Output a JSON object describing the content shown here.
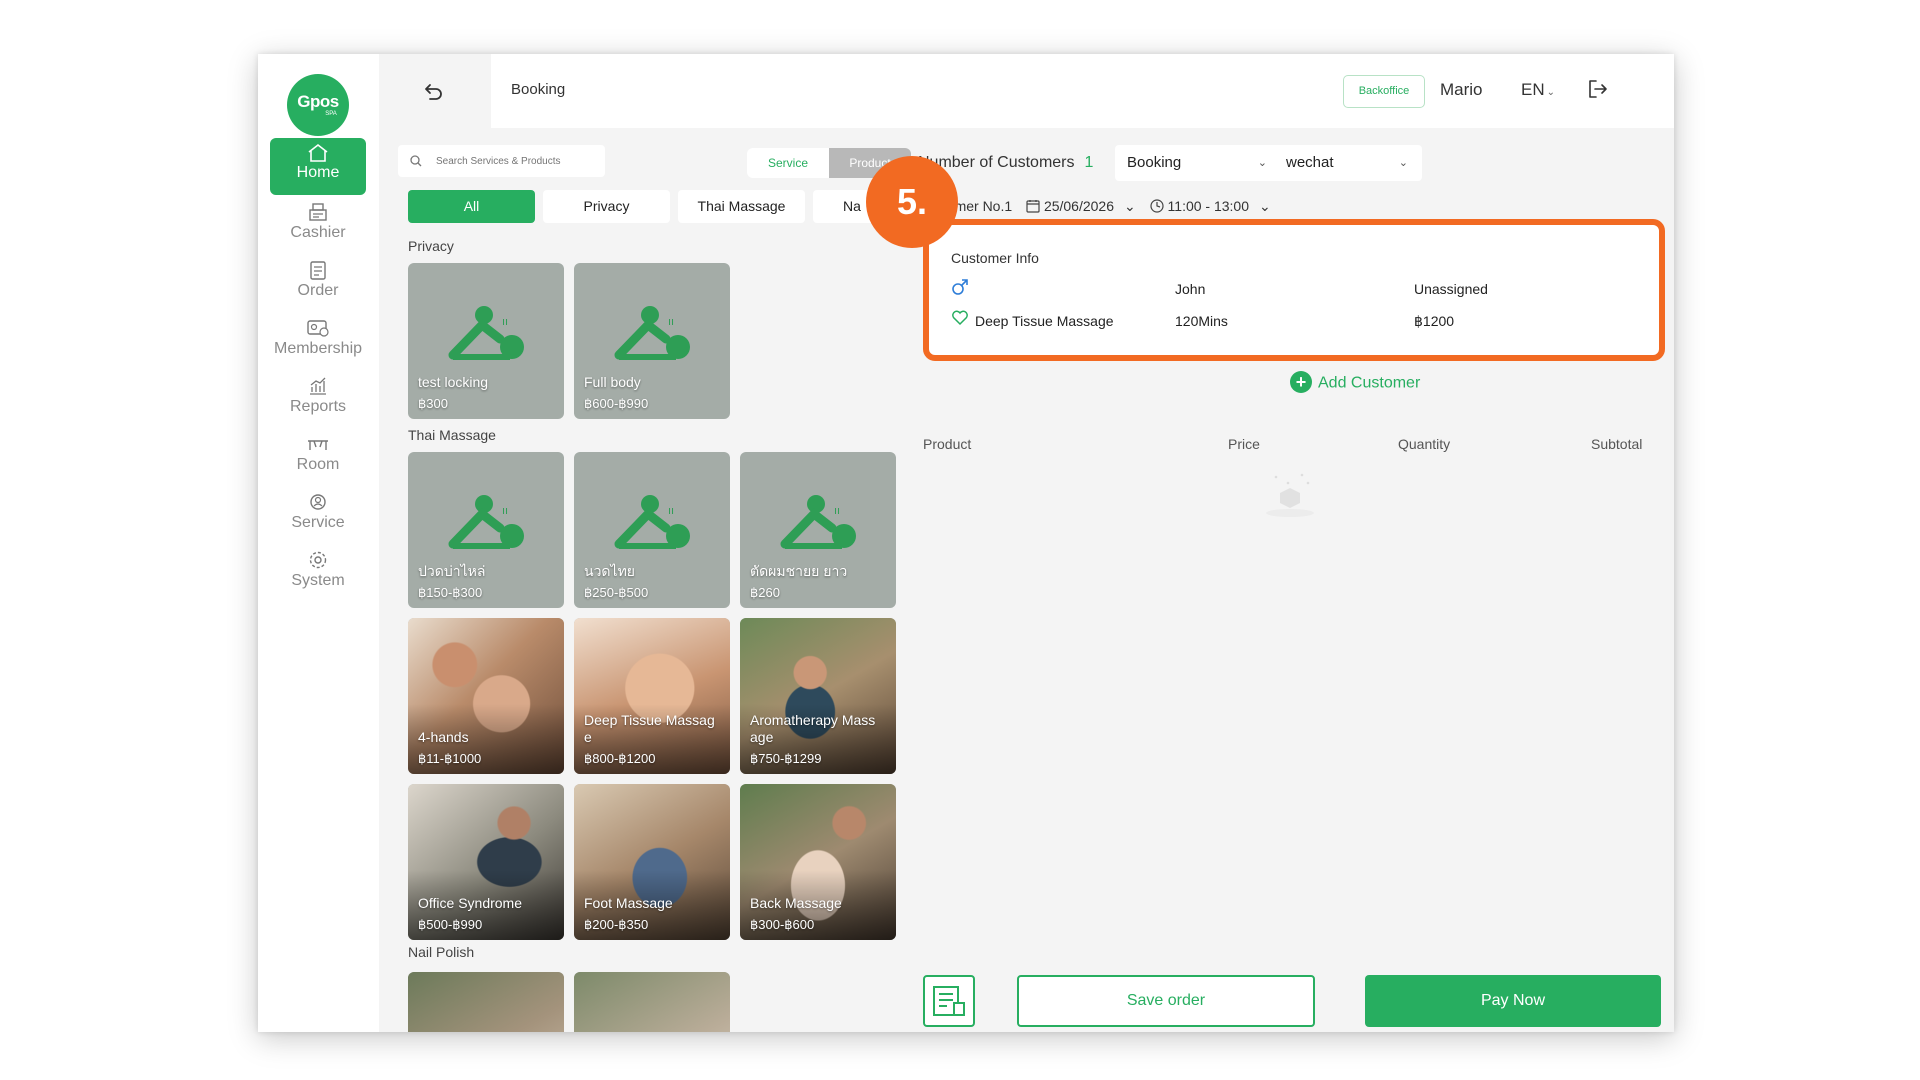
{
  "app": {
    "logo_text": "Gpos",
    "logo_sub": "SPA"
  },
  "sidebar": {
    "items": [
      {
        "label": "Home",
        "icon": "home-icon",
        "active": true
      },
      {
        "label": "Cashier",
        "icon": "cashier-icon"
      },
      {
        "label": "Order",
        "icon": "order-icon"
      },
      {
        "label": "Membership",
        "icon": "membership-icon"
      },
      {
        "label": "Reports",
        "icon": "reports-icon"
      },
      {
        "label": "Room",
        "icon": "room-icon"
      },
      {
        "label": "Service",
        "icon": "service-icon"
      },
      {
        "label": "System",
        "icon": "system-icon"
      }
    ]
  },
  "header": {
    "title": "Booking",
    "backoffice_label": "Backoffice",
    "user": "Mario",
    "language": "EN"
  },
  "search": {
    "placeholder": "Search Services & Products"
  },
  "segment": {
    "service": "Service",
    "product": "Product"
  },
  "categories": [
    "All",
    "Privacy",
    "Thai Massage",
    "Na"
  ],
  "sections": {
    "privacy": "Privacy",
    "thai": "Thai Massage",
    "nail": "Nail Polish"
  },
  "cards": [
    {
      "name": "test locking",
      "price": "฿300"
    },
    {
      "name": "Full body",
      "price": "฿600-฿990"
    },
    {
      "name": "ปวดบ่าไหล่",
      "price": "฿150-฿300"
    },
    {
      "name": "นวดไทย",
      "price": "฿250-฿500"
    },
    {
      "name": "ตัดผมชายย ยาว",
      "price": "฿260"
    },
    {
      "name": "4-hands",
      "price": "฿11-฿1000"
    },
    {
      "name": "Deep Tissue Massag e",
      "price": "฿800-฿1200"
    },
    {
      "name": "Aromatherapy Mass age",
      "price": "฿750-฿1299"
    },
    {
      "name": "Office Syndrome",
      "price": "฿500-฿990"
    },
    {
      "name": "Foot Massage",
      "price": "฿200-฿350"
    },
    {
      "name": "Back Massage",
      "price": "฿300-฿600"
    }
  ],
  "booking": {
    "number_label": "Number of Customers",
    "number_value": "1",
    "type_value": "Booking",
    "channel_value": "wechat",
    "customer_no": "Customer No.1",
    "date": "25/06/2026",
    "time": "11:00 - 13:00"
  },
  "customer_info": {
    "title": "Customer Info",
    "name": "John",
    "therapist": "Unassigned",
    "service": "Deep Tissue Massage",
    "duration": "120Mins",
    "price": "฿1200"
  },
  "step_badge": "5.",
  "add_customer": "Add Customer",
  "table_headers": {
    "product": "Product",
    "price": "Price",
    "quantity": "Quantity",
    "subtotal": "Subtotal"
  },
  "actions": {
    "save": "Save order",
    "pay": "Pay Now"
  },
  "colors": {
    "accent": "#27ae60",
    "highlight": "#f26a22"
  }
}
